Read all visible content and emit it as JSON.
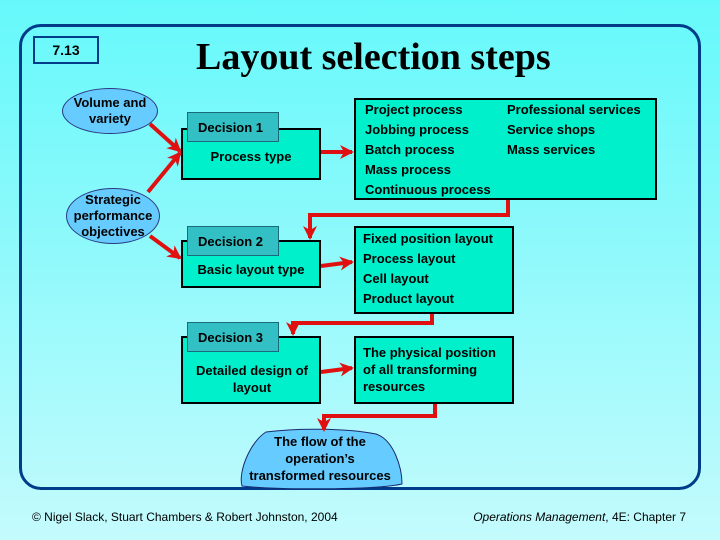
{
  "slide": {
    "number": "7.13",
    "title": "Layout selection steps"
  },
  "inputs": {
    "volume_variety": "Volume and variety",
    "strategic_objectives": [
      "Strategic",
      "performance",
      "objectives"
    ]
  },
  "decisions": [
    {
      "tab": "Decision 1",
      "label": "Process type"
    },
    {
      "tab": "Decision 2",
      "label": "Basic layout type"
    },
    {
      "tab": "Decision 3",
      "label": "Detailed design of layout"
    }
  ],
  "outcomes": {
    "process_types": {
      "manufacturing": [
        "Project process",
        "Jobbing process",
        "Batch process",
        "Mass process",
        "Continuous process"
      ],
      "services": [
        "Professional services",
        "Service shops",
        "Mass services"
      ]
    },
    "layout_types": [
      "Fixed position layout",
      "Process layout",
      "Cell layout",
      "Product layout"
    ],
    "detailed_design": [
      "The physical position",
      "of all transforming",
      "resources"
    ]
  },
  "result": [
    "The flow of the",
    "operation’s",
    "transformed resources"
  ],
  "colors": {
    "arrow": "#e01010",
    "box_fill": "#00f0cc",
    "tab_fill": "#33c0c4",
    "ellipse_fill": "#66ccff",
    "frame": "#003c8a"
  },
  "footer": {
    "copyright": "© Nigel Slack, Stuart Chambers & Robert Johnston, 2004",
    "book_title": "Operations Management",
    "book_suffix": ", 4E: Chapter 7"
  }
}
